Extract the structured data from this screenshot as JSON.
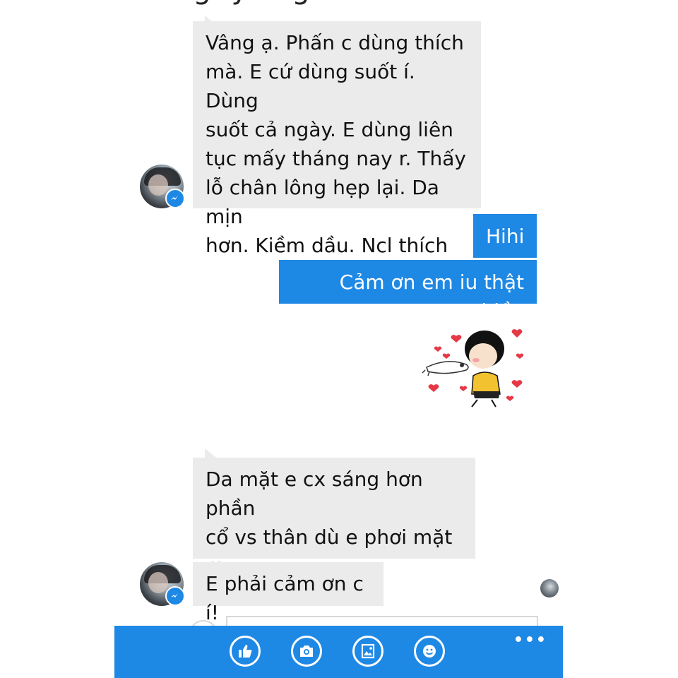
{
  "header_fragment": "ng y    ng",
  "messages": [
    {
      "side": "in",
      "text": "Vâng ạ. Phấn c dùng thích\nmà. E cứ dùng suốt í. Dùng\nsuốt cả ngày. E dùng liên\ntục mấy tháng nay r. Thấy\nlỗ chân lông hẹp lại. Da mịn\nhơn. Kiềm dầu. Ncl thích"
    },
    {
      "side": "out",
      "text": "Hihi"
    },
    {
      "side": "out",
      "text": "Cảm ơn em iu thật nhiều"
    },
    {
      "side": "out",
      "type": "sticker",
      "sticker": "girl-hugging-cat-with-hearts"
    },
    {
      "side": "in",
      "text": "Da mặt e cx sáng hơn phần\ncổ vs thân dù e phơi mặt ra\nngoài cx khá nh"
    },
    {
      "side": "in",
      "text": "E phải cảm ơn c í!"
    }
  ],
  "appbar": {
    "buttons": [
      {
        "icon": "thumbs-up-icon"
      },
      {
        "icon": "camera-icon"
      },
      {
        "icon": "photos-icon"
      },
      {
        "icon": "emoji-icon"
      }
    ],
    "more_label": "•••"
  },
  "colors": {
    "accent": "#1e88e5",
    "incoming_bubble": "#ebebeb",
    "outgoing_text": "#ffffff"
  }
}
